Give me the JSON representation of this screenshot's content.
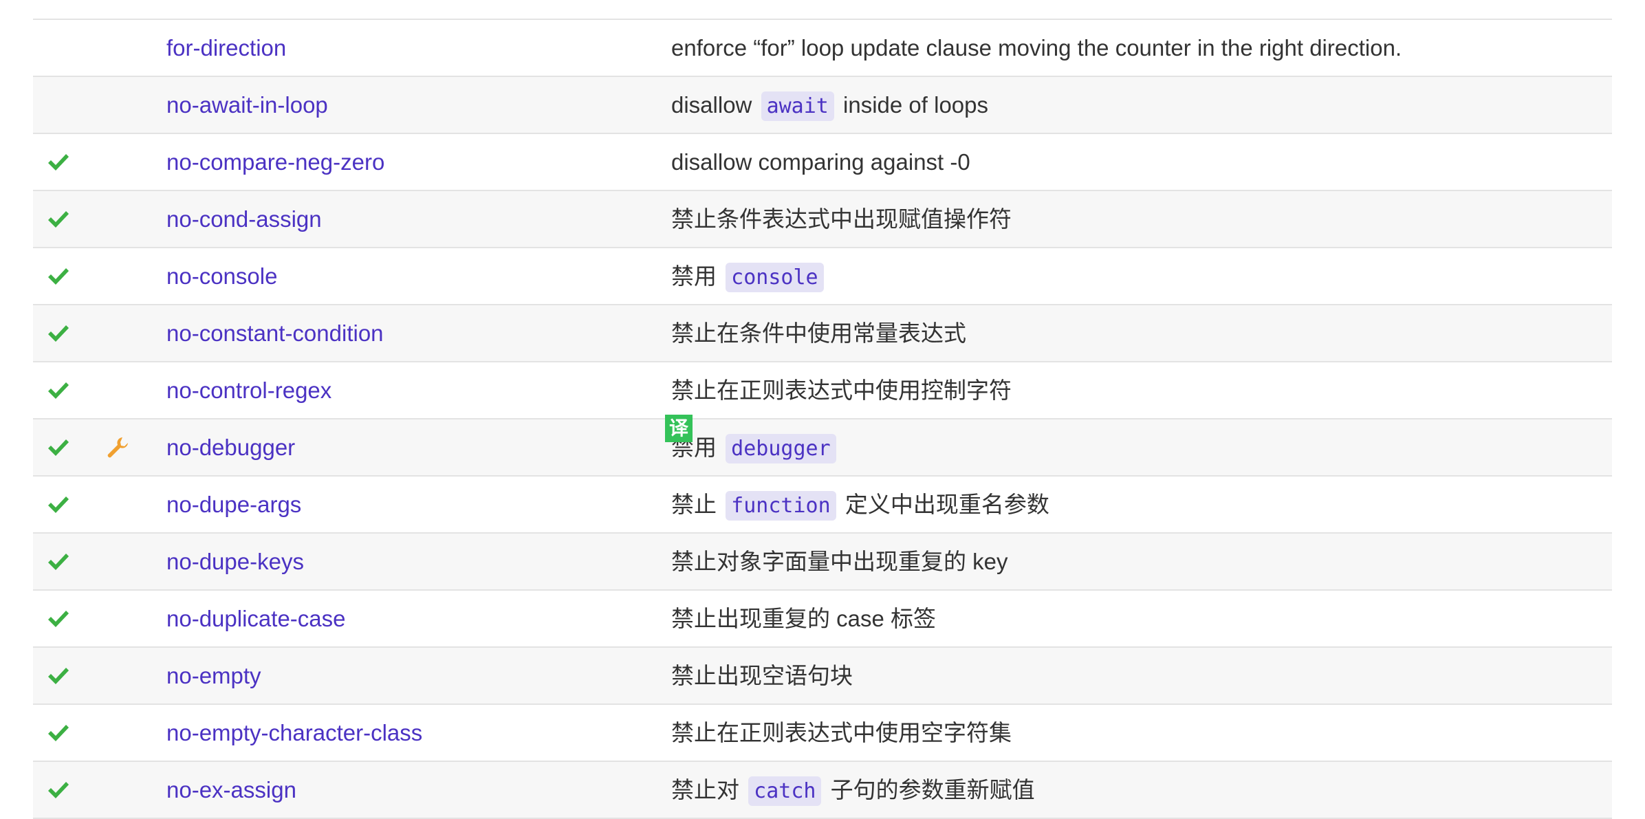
{
  "colors": {
    "link": "#4b32c3",
    "check": "#3cb043",
    "wrench": "#f0a030",
    "code_bg": "#e4e2f5",
    "translate_badge": "#34c259"
  },
  "translate_badge": "译",
  "rules": [
    {
      "recommended": false,
      "fixable": false,
      "name": "for-direction",
      "desc": [
        {
          "t": "enforce “for” loop update clause moving the counter in the right direction."
        }
      ]
    },
    {
      "recommended": false,
      "fixable": false,
      "name": "no-await-in-loop",
      "desc": [
        {
          "t": "disallow "
        },
        {
          "code": "await"
        },
        {
          "t": " inside of loops"
        }
      ]
    },
    {
      "recommended": true,
      "fixable": false,
      "name": "no-compare-neg-zero",
      "desc": [
        {
          "t": "disallow comparing against -0"
        }
      ]
    },
    {
      "recommended": true,
      "fixable": false,
      "name": "no-cond-assign",
      "desc": [
        {
          "t": "禁止条件表达式中出现赋值操作符"
        }
      ]
    },
    {
      "recommended": true,
      "fixable": false,
      "name": "no-console",
      "desc": [
        {
          "t": "禁用 "
        },
        {
          "code": "console"
        }
      ]
    },
    {
      "recommended": true,
      "fixable": false,
      "name": "no-constant-condition",
      "desc": [
        {
          "t": "禁止在条件中使用常量表达式"
        }
      ]
    },
    {
      "recommended": true,
      "fixable": false,
      "name": "no-control-regex",
      "desc": [
        {
          "t": "禁止在正则表达式中使用控制字符"
        }
      ]
    },
    {
      "recommended": true,
      "fixable": true,
      "name": "no-debugger",
      "desc": [
        {
          "t": "禁用 "
        },
        {
          "code": "debugger"
        }
      ]
    },
    {
      "recommended": true,
      "fixable": false,
      "name": "no-dupe-args",
      "desc": [
        {
          "t": "禁止 "
        },
        {
          "code": "function"
        },
        {
          "t": " 定义中出现重名参数"
        }
      ]
    },
    {
      "recommended": true,
      "fixable": false,
      "name": "no-dupe-keys",
      "desc": [
        {
          "t": "禁止对象字面量中出现重复的 key"
        }
      ]
    },
    {
      "recommended": true,
      "fixable": false,
      "name": "no-duplicate-case",
      "desc": [
        {
          "t": "禁止出现重复的 case 标签"
        }
      ]
    },
    {
      "recommended": true,
      "fixable": false,
      "name": "no-empty",
      "desc": [
        {
          "t": "禁止出现空语句块"
        }
      ]
    },
    {
      "recommended": true,
      "fixable": false,
      "name": "no-empty-character-class",
      "desc": [
        {
          "t": "禁止在正则表达式中使用空字符集"
        }
      ]
    },
    {
      "recommended": true,
      "fixable": false,
      "name": "no-ex-assign",
      "desc": [
        {
          "t": "禁止对 "
        },
        {
          "code": "catch"
        },
        {
          "t": " 子句的参数重新赋值"
        }
      ]
    }
  ]
}
